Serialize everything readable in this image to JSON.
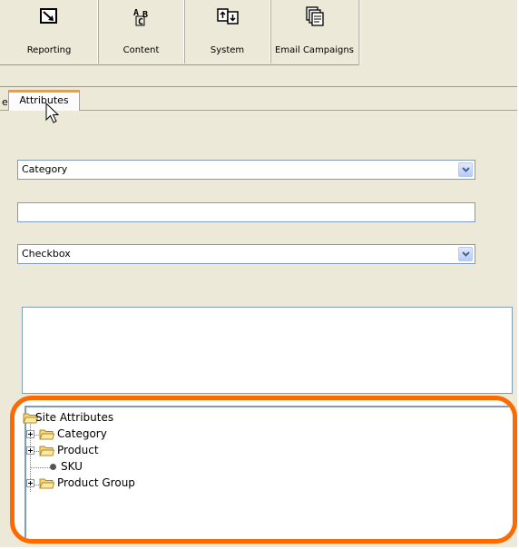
{
  "toolbar": {
    "buttons": [
      {
        "label": "Reporting",
        "icon": "reporting-icon"
      },
      {
        "label": "Content",
        "icon": "content-icon"
      },
      {
        "label": "System",
        "icon": "system-icon"
      },
      {
        "label": "Email Campaigns",
        "icon": "email-campaigns-icon"
      }
    ]
  },
  "tabs": {
    "partial_prev_label": "e",
    "active_label": "Attributes"
  },
  "form": {
    "select1_value": "Category",
    "text_value": "",
    "select2_value": "Checkbox",
    "textarea_value": ""
  },
  "tree": {
    "root": "Site Attributes",
    "items": [
      {
        "label": "Category",
        "type": "folder",
        "expandable": true
      },
      {
        "label": "Product",
        "type": "folder",
        "expandable": true
      },
      {
        "label": "SKU",
        "type": "leaf",
        "expandable": false
      },
      {
        "label": "Product Group",
        "type": "folder",
        "expandable": true
      }
    ]
  },
  "colors": {
    "window_bg": "#ece9d8",
    "highlight_ring": "#ff6a00",
    "active_tab_accent": "#ff9b1e",
    "field_border": "#7f9db9"
  }
}
